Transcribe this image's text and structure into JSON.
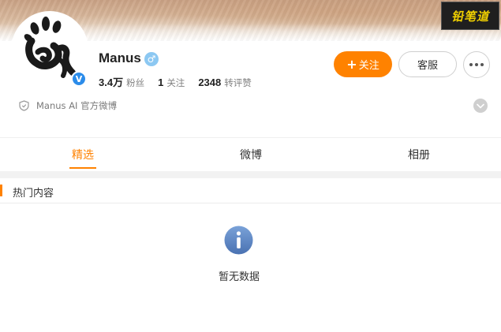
{
  "cover": {
    "watermark_text": "铅笔道"
  },
  "profile": {
    "name": "Manus",
    "gender_icon": "male-icon",
    "verified_icon": "verified-v-icon",
    "stats": [
      {
        "value": "3.4万",
        "label": "粉丝"
      },
      {
        "value": "1",
        "label": "关注"
      },
      {
        "value": "2348",
        "label": "转评赞"
      }
    ],
    "verification": "Manus AI 官方微博"
  },
  "actions": {
    "follow_label": "关注",
    "service_label": "客服"
  },
  "tabs": [
    {
      "label": "精选",
      "active": true
    },
    {
      "label": "微博",
      "active": false
    },
    {
      "label": "相册",
      "active": false
    }
  ],
  "section": {
    "title": "热门内容"
  },
  "empty_state": {
    "text": "暂无数据"
  },
  "colors": {
    "accent": "#ff8200",
    "verified_blue": "#2b8cea",
    "info_icon": "#5b86c6"
  }
}
